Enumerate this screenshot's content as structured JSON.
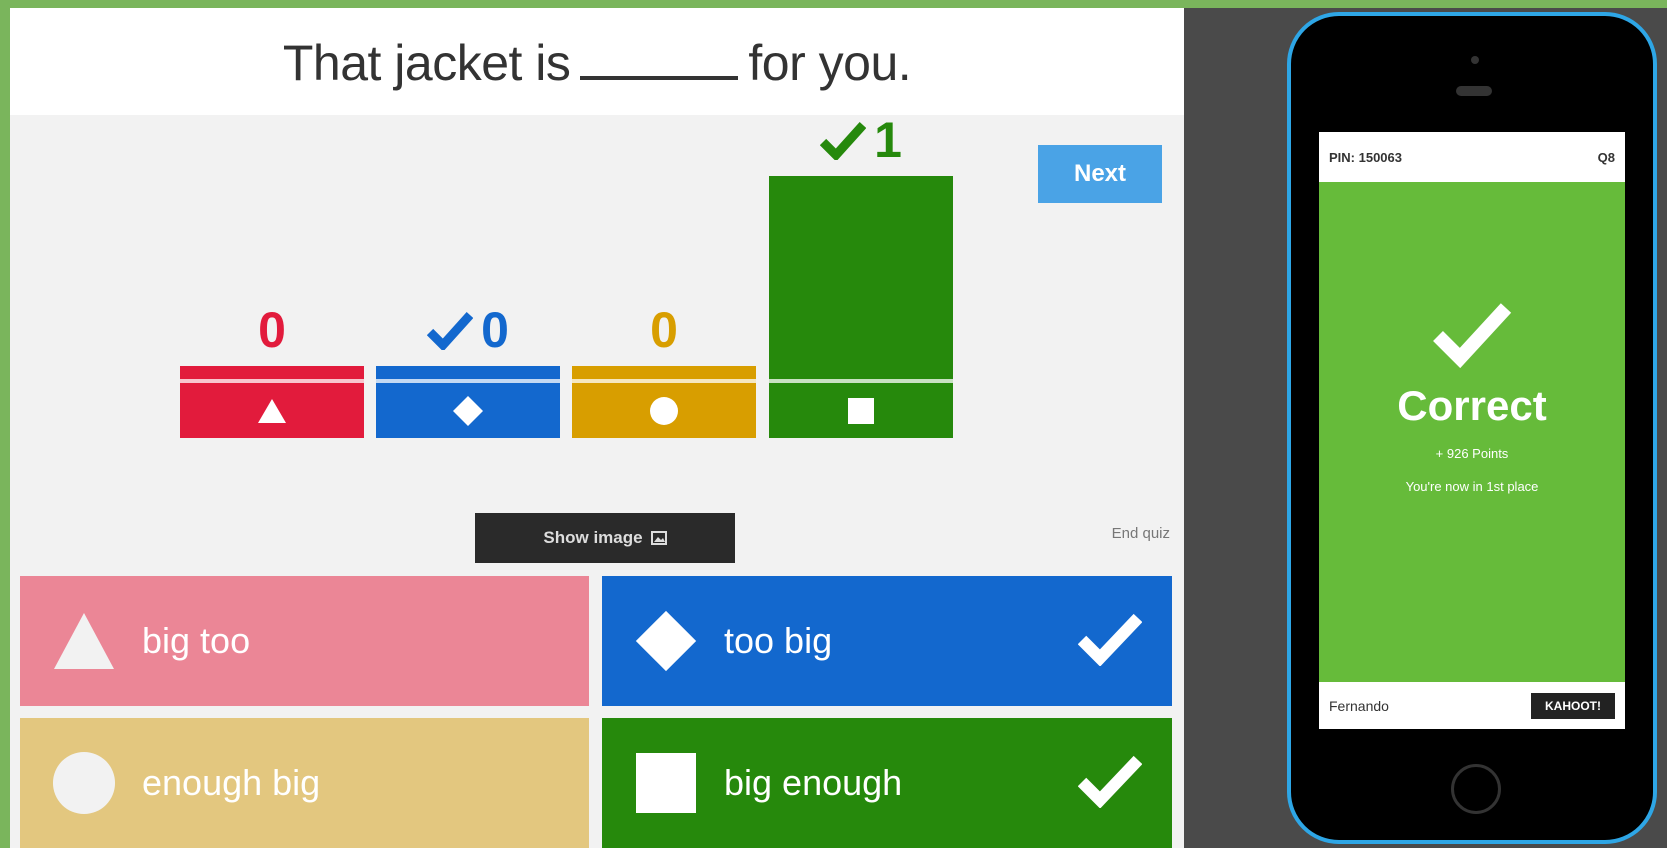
{
  "question": {
    "before": "That jacket is",
    "after": "for you."
  },
  "next_label": "Next",
  "results": [
    {
      "id": "red",
      "count": "0",
      "correct": false,
      "color": "#e21b3c",
      "shape": "triangle",
      "answers": 0
    },
    {
      "id": "blue",
      "count": "0",
      "correct": true,
      "color": "#1368ce",
      "shape": "diamond",
      "answers": 0
    },
    {
      "id": "yellow",
      "count": "0",
      "correct": false,
      "color": "#d89e00",
      "shape": "circle",
      "answers": 0
    },
    {
      "id": "green",
      "count": "1",
      "correct": true,
      "color": "#26890c",
      "shape": "square",
      "answers": 1
    }
  ],
  "show_image_label": "Show image",
  "end_quiz_label": "End quiz",
  "answers": [
    {
      "label": "big too",
      "shape": "triangle",
      "color": "#eb8696",
      "correct": false
    },
    {
      "label": "too big",
      "shape": "diamond",
      "color": "#1368ce",
      "correct": true
    },
    {
      "label": "enough big",
      "shape": "circle",
      "color": "#e3c77f",
      "correct": false
    },
    {
      "label": "big enough",
      "shape": "square",
      "color": "#26890c",
      "correct": true
    }
  ],
  "phone": {
    "pin": "PIN: 150063",
    "question_no": "Q8",
    "status": "Correct",
    "points": "+ 926 Points",
    "place": "You're now in 1st place",
    "player": "Fernando",
    "button": "KAHOOT!"
  },
  "icons": {
    "check": "check-icon",
    "image": "image-icon",
    "triangle": "triangle-icon",
    "diamond": "diamond-icon",
    "circle": "circle-icon",
    "square": "square-icon"
  }
}
